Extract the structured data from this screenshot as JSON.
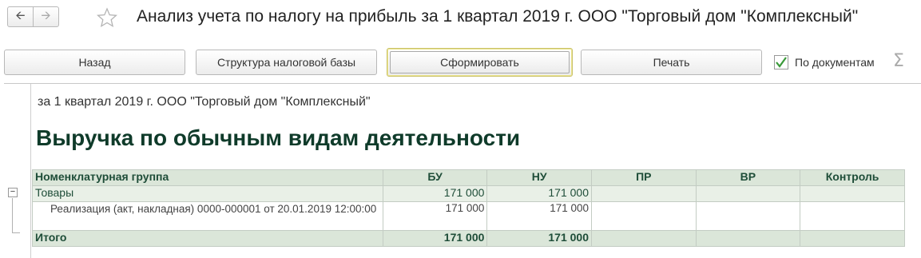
{
  "window": {
    "title": "Анализ учета по налогу на прибыль за 1 квартал 2019 г. ООО \"Торговый дом \"Комплексный\""
  },
  "nav": {
    "back_icon": "arrow-left-icon",
    "forward_icon": "arrow-right-icon",
    "favorite_icon": "star-icon"
  },
  "toolbar": {
    "back_label": "Назад",
    "structure_label": "Структура налоговой базы",
    "generate_label": "Сформировать",
    "print_label": "Печать",
    "by_documents_label": "По документам",
    "by_documents_checked": true,
    "sum_icon": "sigma-icon"
  },
  "report": {
    "subtitle": "за 1 квартал 2019 г. ООО \"Торговый дом \"Комплексный\"",
    "heading": "Выручка по обычным видам деятельности",
    "columns": [
      "Номенклатурная группа",
      "БУ",
      "НУ",
      "ПР",
      "ВР",
      "Контроль"
    ],
    "group_row": {
      "name": "Товары",
      "bu": "171 000",
      "nu": "171 000",
      "pr": "",
      "vr": "",
      "control": ""
    },
    "detail_row": {
      "name": "Реализация (акт, накладная) 0000-000001 от 20.01.2019 12:00:00",
      "bu": "171 000",
      "nu": "171 000",
      "pr": "",
      "vr": "",
      "control": ""
    },
    "total_row": {
      "name": "Итого",
      "bu": "171 000",
      "nu": "171 000",
      "pr": "",
      "vr": "",
      "control": ""
    }
  },
  "colors": {
    "heading": "#0f3b2a",
    "header_bg": "#dbe6d9",
    "group_bg": "#e9f0e7",
    "default_button_border": "#c9c16a",
    "checkbox_mark": "#3a9a3a"
  }
}
